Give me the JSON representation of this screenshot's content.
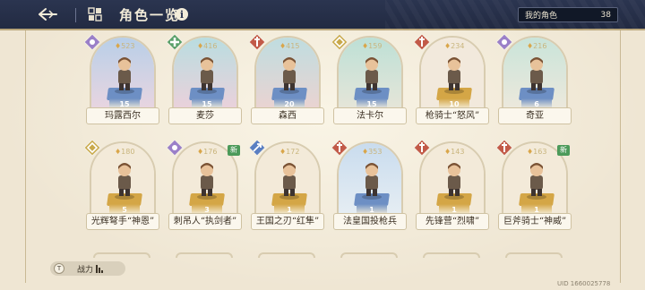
{
  "header": {
    "title": "角色一览",
    "my_characters_label": "我的角色",
    "my_characters_count": "38"
  },
  "footer": {
    "filter_icon_letter": "T",
    "filter_label": "战力",
    "uid": "UID 1660025778"
  },
  "colors": {
    "header_bg": "#242c45",
    "panel_bg": "#efe6d3",
    "accent_gold": "#c9b57d"
  },
  "characters": [
    {
      "name": "玛露西尔",
      "power": "523",
      "level": "15",
      "class_icon": "magic-class-icon",
      "class_color": "#9a7fc8",
      "bg": [
        "#b8cfe8",
        "#f0d6df"
      ],
      "plat": "#6d8fc4",
      "new": ""
    },
    {
      "name": "麦莎",
      "power": "416",
      "level": "15",
      "class_icon": "heal-class-icon",
      "class_color": "#5aa06b",
      "bg": [
        "#b9dde0",
        "#f2cfda"
      ],
      "plat": "#6d8fc4",
      "new": ""
    },
    {
      "name": "森西",
      "power": "415",
      "level": "20",
      "class_icon": "guard-class-icon",
      "class_color": "#c25a48",
      "bg": [
        "#bfdde0",
        "#f1d2cf"
      ],
      "plat": "#6d8fc4",
      "new": ""
    },
    {
      "name": "法卡尔",
      "power": "159",
      "level": "15",
      "class_icon": "support-class-icon",
      "class_color": "#c9a94b",
      "bg": [
        "#bde0d6",
        "#ece6d9"
      ],
      "plat": "#6d8fc4",
      "new": ""
    },
    {
      "name": "枪骑士“怒风”",
      "power": "234",
      "level": "10",
      "class_icon": "guard-class-icon",
      "class_color": "#c25a48",
      "bg": [
        "#f2e9dc",
        "#f2e9dc"
      ],
      "plat": "#d4a646",
      "new": ""
    },
    {
      "name": "奇亚",
      "power": "216",
      "level": "6",
      "class_icon": "magic-class-icon",
      "class_color": "#9a7fc8",
      "bg": [
        "#c9e4da",
        "#f2e9dc"
      ],
      "plat": "#6d8fc4",
      "new": ""
    },
    {
      "name": "光辉弩手“神恩”",
      "power": "180",
      "level": "5",
      "class_icon": "support-class-icon",
      "class_color": "#c9a94b",
      "bg": [
        "#f3ead9",
        "#f3ead9"
      ],
      "plat": "#d4a646",
      "new": ""
    },
    {
      "name": "刺吊人“执剑者”",
      "power": "176",
      "level": "3",
      "class_icon": "magic-class-icon",
      "class_color": "#9a7fc8",
      "bg": [
        "#f3ead9",
        "#f3ead9"
      ],
      "plat": "#d4a646",
      "new": "新"
    },
    {
      "name": "王国之刃“红隼”",
      "power": "172",
      "level": "1",
      "class_icon": "assault-class-icon",
      "class_color": "#5a7fc2",
      "bg": [
        "#f3ead9",
        "#f3ead9"
      ],
      "plat": "#d4a646",
      "new": ""
    },
    {
      "name": "法皇国投枪兵",
      "power": "353",
      "level": "1",
      "class_icon": "guard-class-icon",
      "class_color": "#c25a48",
      "bg": [
        "#c9dcee",
        "#eaf0f4"
      ],
      "plat": "#6d8fc4",
      "new": ""
    },
    {
      "name": "先锋营“烈啸”",
      "power": "143",
      "level": "1",
      "class_icon": "guard-class-icon",
      "class_color": "#c25a48",
      "bg": [
        "#f3ead9",
        "#f3ead9"
      ],
      "plat": "#d4a646",
      "new": ""
    },
    {
      "name": "巨斧骑士“神威”",
      "power": "163",
      "level": "1",
      "class_icon": "guard-class-icon",
      "class_color": "#c25a48",
      "bg": [
        "#f3ead9",
        "#f3ead9"
      ],
      "plat": "#d4a646",
      "new": "新"
    }
  ]
}
